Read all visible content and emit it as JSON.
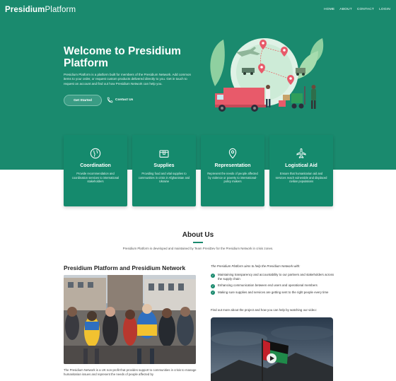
{
  "header": {
    "logo_bold": "Presidium",
    "logo_light": "Platform",
    "nav": [
      "HOME",
      "ABOUT",
      "CONTACT",
      "LOGIN"
    ]
  },
  "hero": {
    "title": "Welcome to Presidium Platform",
    "description": "Presidium Platform is a platform built for members of the Presidium Network. Add common items to your order, or request custom products delivered directly to you. Get in touch to request an account and find out how Presidium Network can help you.",
    "cta_label": "Get Started",
    "contact_label": "Contact Us"
  },
  "services": [
    {
      "title": "Coordination",
      "text": "Provide recommendation and coordination services to international stakeholders",
      "icon": "globe-icon"
    },
    {
      "title": "Supplies",
      "text": "Providing food and vital supplies to communities in crisis in Afghanistan and Ukraine",
      "icon": "box-icon"
    },
    {
      "title": "Representation",
      "text": "Represent the needs of people affected by violence or poverty to international-policy makers",
      "icon": "map-pin-icon"
    },
    {
      "title": "Logistical Aid",
      "text": "Ensure that humanitarian aid and services reach vulnerable and displaced civilian populations",
      "icon": "airplane-icon"
    }
  ],
  "about": {
    "title": "About Us",
    "description": "Presidium Platform is developed and maintained by Team PresiDev for the Presidium Network in crisis zones.",
    "section_title": "Presidium Platform and Presidium Network",
    "body": "The Presidium Network is a UK non-profit that provides support to communities in crisis to manage humanitarian issues and represent the needs of people affected by",
    "intro_italic": "The Presidium Platform",
    "intro_rest": " aims to help the Presidium Network with:",
    "checks": [
      "Maintaining transparency and accountability to our partners and stakeholders across the supply chain",
      "Enhancing communication between end users and operational members",
      "Making sure supplies and services are getting sent to the right people every time"
    ],
    "video_prompt": "Find out more about the project and how you can help by watching our video:"
  },
  "colors": {
    "brand": "#1a8a6e",
    "card": "#158a6d"
  }
}
